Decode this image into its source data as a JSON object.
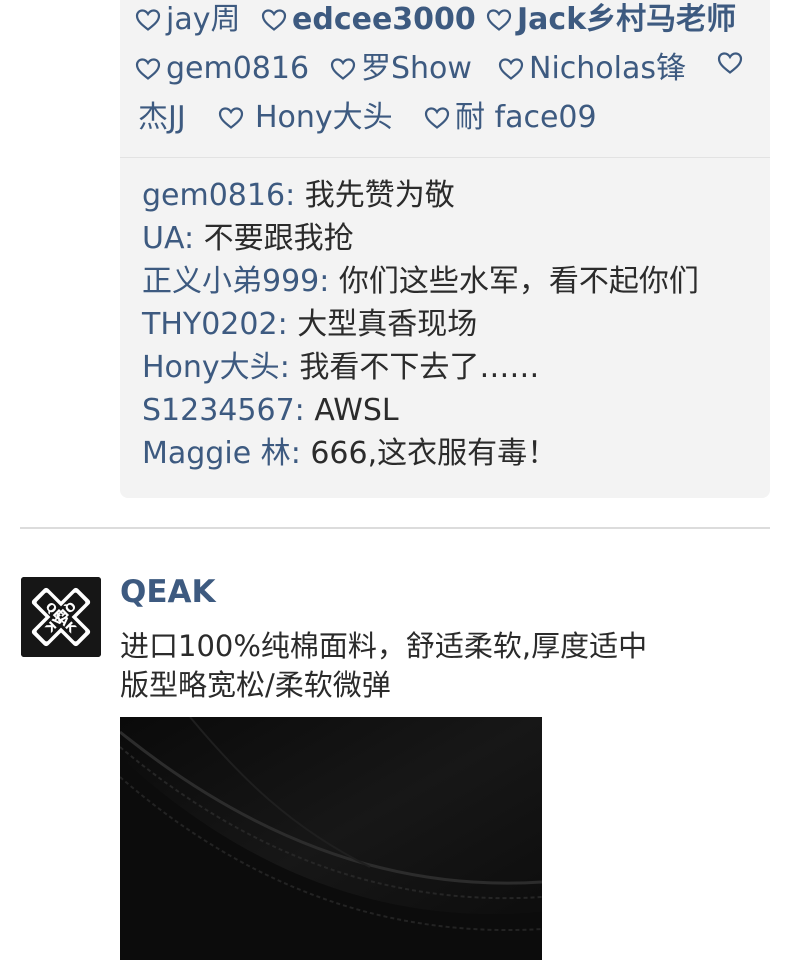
{
  "likes": [
    "jay周",
    "edcee3000",
    "Jack乡村马老师",
    "gem0816",
    "罗Show",
    "Nicholas锋",
    "杰JJ",
    "Hony大头",
    "耐 face09"
  ],
  "comments": [
    {
      "user": "gem0816",
      "text": "我先赞为敬"
    },
    {
      "user": "UA",
      "text": "不要跟我抢"
    },
    {
      "user": "正义小弟999",
      "text": "你们这些水军，看不起你们"
    },
    {
      "user": "THY0202",
      "text": "大型真香现场"
    },
    {
      "user": "Hony大头",
      "text": "我看不下去了……"
    },
    {
      "user": "S1234567",
      "text": "AWSL"
    },
    {
      "user": "Maggie 林",
      "text": "666,这衣服有毒！"
    }
  ],
  "comment_separator": ": ",
  "post": {
    "author": "QEAK",
    "avatar_logo_text": "QEAK",
    "text_line1": "进口100%纯棉面料，舒适柔软,厚度适中",
    "text_line2": "版型略宽松/柔软微弹",
    "photo_icon": "black-tshirt-collar-photo"
  },
  "colors": {
    "link_blue": "#3d5a80",
    "text_dark": "#2b2b2b",
    "box_bg": "#f3f3f3"
  }
}
